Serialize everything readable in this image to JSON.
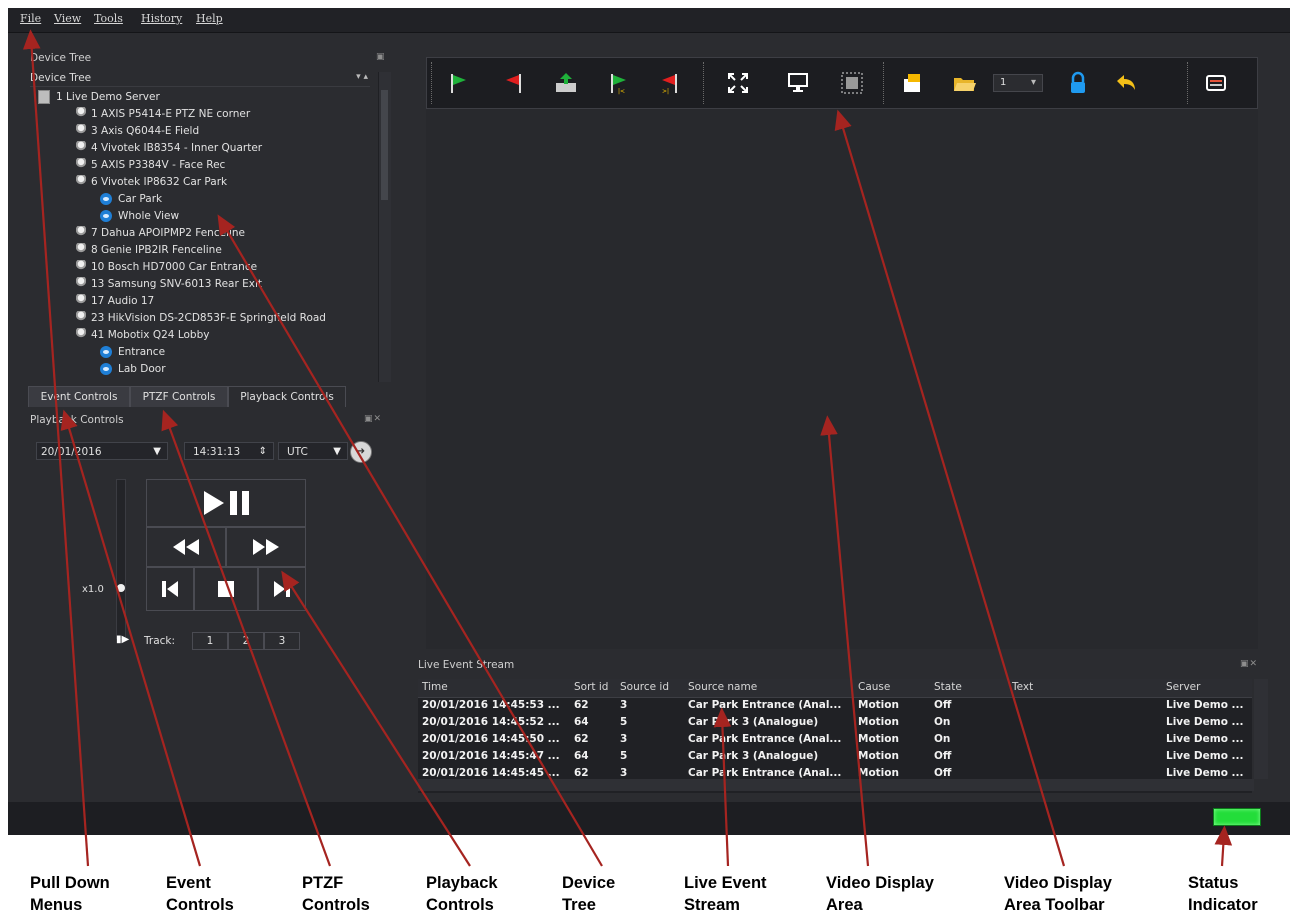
{
  "menubar": {
    "items": [
      "File",
      "View",
      "Tools",
      "History",
      "Help"
    ]
  },
  "device_tree": {
    "dock_title": "Device Tree",
    "combo_value": "Device Tree",
    "items": [
      {
        "label": "1 Live Demo Server",
        "type": "server",
        "indent": 0
      },
      {
        "label": "1 AXIS P5414-E PTZ NE corner",
        "type": "camera",
        "indent": 1
      },
      {
        "label": "3 Axis Q6044-E Field",
        "type": "camera",
        "indent": 1
      },
      {
        "label": "4 Vivotek IB8354 - Inner Quarter",
        "type": "camera",
        "indent": 1
      },
      {
        "label": "5 AXIS P3384V - Face Rec",
        "type": "camera",
        "indent": 1
      },
      {
        "label": "6 Vivotek IP8632 Car Park",
        "type": "camera",
        "indent": 1
      },
      {
        "label": "Car Park",
        "type": "view",
        "indent": 2
      },
      {
        "label": "Whole View",
        "type": "view",
        "indent": 2
      },
      {
        "label": "7 Dahua APOIPMP2 Fenceline",
        "type": "camera",
        "indent": 1
      },
      {
        "label": "8 Genie IPB2IR Fenceline",
        "type": "camera",
        "indent": 1
      },
      {
        "label": "10 Bosch HD7000 Car Entrance",
        "type": "camera",
        "indent": 1
      },
      {
        "label": "13 Samsung SNV-6013 Rear Exit",
        "type": "camera",
        "indent": 1
      },
      {
        "label": "17 Audio 17",
        "type": "audio",
        "indent": 1
      },
      {
        "label": "23 HikVision DS-2CD853F-E Springfield Road",
        "type": "camera",
        "indent": 1
      },
      {
        "label": "41 Mobotix Q24 Lobby",
        "type": "camera",
        "indent": 1
      },
      {
        "label": "Entrance",
        "type": "view",
        "indent": 2
      },
      {
        "label": "Lab Door",
        "type": "view",
        "indent": 2
      }
    ]
  },
  "tabs": [
    "Event Controls",
    "PTZF Controls",
    "Playback Controls"
  ],
  "playback": {
    "dock_title": "Playback Controls",
    "date": "20/01/2016",
    "time": "14:31:13",
    "timezone": "UTC",
    "speed": "x1.0",
    "track_label": "Track:",
    "tracks": [
      "1",
      "2",
      "3"
    ]
  },
  "toolbar": {
    "icons": [
      "flag-green-start-icon",
      "flag-red-end-icon",
      "export-clip-icon",
      "jump-start-icon",
      "jump-end-icon",
      "fullscreen-icon",
      "monitor-icon",
      "select-region-icon",
      "snapshot-icon",
      "open-folder-icon",
      "lock-icon",
      "undo-icon",
      "layout-icon"
    ],
    "layout_value": "1"
  },
  "event_stream": {
    "title": "Live Event Stream",
    "columns": [
      "Time",
      "Sort id",
      "Source id",
      "Source name",
      "Cause",
      "State",
      "Text",
      "Server"
    ],
    "rows": [
      [
        "20/01/2016 14:45:53 ...",
        "62",
        "3",
        "Car Park Entrance (Anal...",
        "Motion",
        "Off",
        "",
        "Live Demo ..."
      ],
      [
        "20/01/2016 14:45:52 ...",
        "64",
        "5",
        "Car Park 3 (Analogue)",
        "Motion",
        "On",
        "",
        "Live Demo ..."
      ],
      [
        "20/01/2016 14:45:50 ...",
        "62",
        "3",
        "Car Park Entrance (Anal...",
        "Motion",
        "On",
        "",
        "Live Demo ..."
      ],
      [
        "20/01/2016 14:45:47 ...",
        "64",
        "5",
        "Car Park 3 (Analogue)",
        "Motion",
        "Off",
        "",
        "Live Demo ..."
      ],
      [
        "20/01/2016 14:45:45 ...",
        "62",
        "3",
        "Car Park Entrance (Anal...",
        "Motion",
        "Off",
        "",
        "Live Demo ..."
      ]
    ]
  },
  "status_indicator": {
    "color": "#23dd3a"
  },
  "callouts": [
    {
      "line1": "Pull Down",
      "line2": "Menus"
    },
    {
      "line1": "Event",
      "line2": "Controls"
    },
    {
      "line1": "PTZF",
      "line2": "Controls"
    },
    {
      "line1": "Playback",
      "line2": "Controls"
    },
    {
      "line1": "Device",
      "line2": "Tree"
    },
    {
      "line1": "Live Event",
      "line2": "Stream"
    },
    {
      "line1": "Video Display",
      "line2": "Area"
    },
    {
      "line1": "Video Display",
      "line2": "Area Toolbar"
    },
    {
      "line1": "Status",
      "line2": "Indicator"
    }
  ],
  "colors": {
    "arrow": "#a52420",
    "accent": "#1f7fd6",
    "background": "#2b2c30"
  }
}
